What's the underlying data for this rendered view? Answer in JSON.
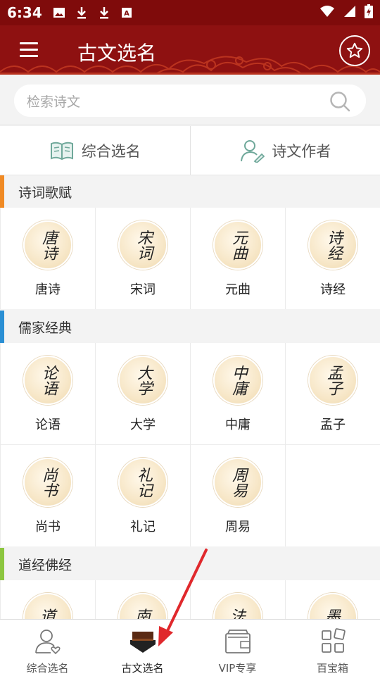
{
  "status_bar": {
    "time": "6:34",
    "icons_left": [
      "image-icon",
      "download-icon",
      "download-icon",
      "font-icon"
    ],
    "icons_right": [
      "wifi-icon",
      "signal-icon",
      "battery-icon"
    ]
  },
  "app_bar": {
    "title": "古文选名",
    "menu_icon": "menu-icon",
    "favorite_icon": "star-icon",
    "bg_color": "#8e1111"
  },
  "search": {
    "placeholder": "检索诗文",
    "icon": "search-icon"
  },
  "seg_tabs": [
    {
      "label": "综合选名",
      "icon": "book-icon"
    },
    {
      "label": "诗文作者",
      "icon": "author-icon"
    }
  ],
  "sections": [
    {
      "title": "诗词歌赋",
      "accent": "#f08a24",
      "items": [
        {
          "name": "唐诗",
          "calligraphy": "唐诗"
        },
        {
          "name": "宋词",
          "calligraphy": "宋词"
        },
        {
          "name": "元曲",
          "calligraphy": "元曲"
        },
        {
          "name": "诗经",
          "calligraphy": "诗经"
        }
      ]
    },
    {
      "title": "儒家经典",
      "accent": "#2a8fd4",
      "items": [
        {
          "name": "论语",
          "calligraphy": "论语"
        },
        {
          "name": "大学",
          "calligraphy": "大学"
        },
        {
          "name": "中庸",
          "calligraphy": "中庸"
        },
        {
          "name": "孟子",
          "calligraphy": "孟子"
        },
        {
          "name": "尚书",
          "calligraphy": "尚书"
        },
        {
          "name": "礼记",
          "calligraphy": "礼记"
        },
        {
          "name": "周易",
          "calligraphy": "周易"
        }
      ]
    },
    {
      "title": "道经佛经",
      "accent": "#8cc63f",
      "items": [
        {
          "calligraphy": "道"
        },
        {
          "calligraphy": "南"
        },
        {
          "calligraphy": "法"
        },
        {
          "calligraphy": "墨"
        }
      ]
    }
  ],
  "bottom_nav": [
    {
      "label": "综合选名",
      "icon": "person-heart-icon",
      "active": false
    },
    {
      "label": "古文选名",
      "icon": "ancient-book-icon",
      "active": true
    },
    {
      "label": "VIP专享",
      "icon": "wallet-icon",
      "active": false
    },
    {
      "label": "百宝箱",
      "icon": "grid-icon",
      "active": false
    }
  ],
  "annotation_arrow_color": "#e0282c"
}
